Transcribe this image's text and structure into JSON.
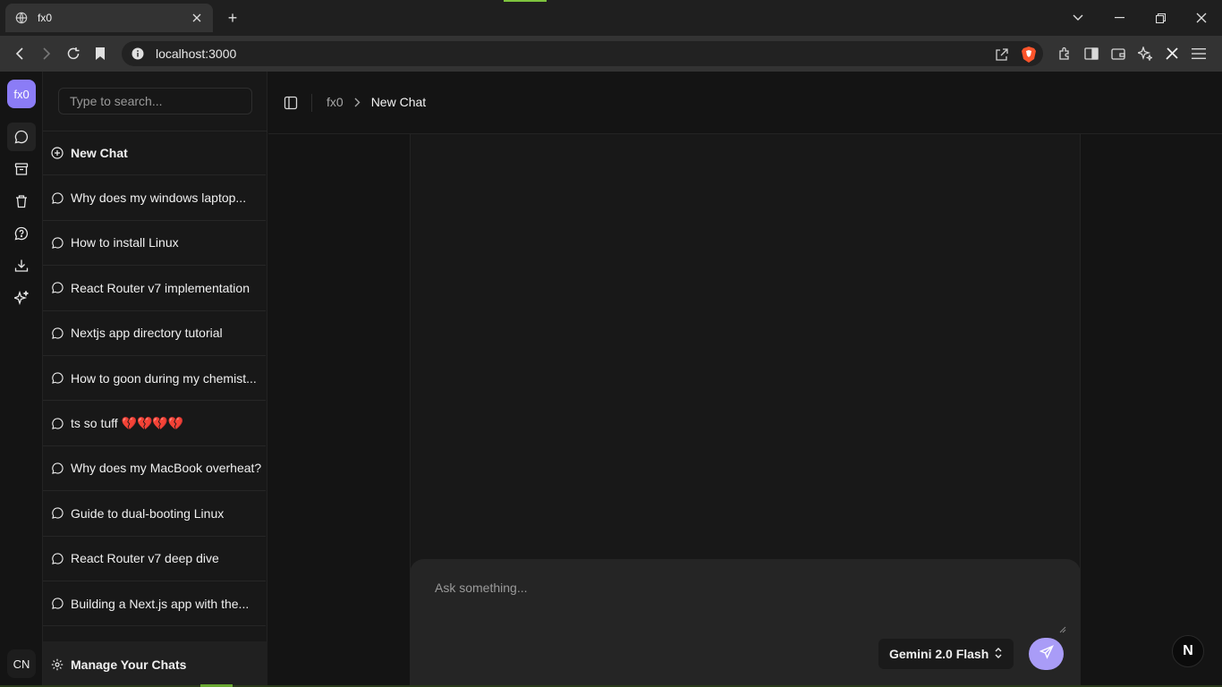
{
  "browser": {
    "tab_title": "fx0",
    "new_tab": "+",
    "url": "localhost:3000"
  },
  "rail": {
    "logo": "fx0",
    "avatar": "CN",
    "icons": [
      "chat-icon",
      "archive-icon",
      "trash-icon",
      "help-icon",
      "download-icon",
      "sparkles-icon"
    ]
  },
  "sidebar": {
    "search_placeholder": "Type to search...",
    "new_chat": "New Chat",
    "chats": [
      {
        "label": "Why does my windows laptop..."
      },
      {
        "label": "How to install Linux"
      },
      {
        "label": "React Router v7 implementation"
      },
      {
        "label": "Nextjs app directory tutorial"
      },
      {
        "label": "How to goon during my chemist..."
      },
      {
        "label": "ts so tuff 💔💔💔💔"
      },
      {
        "label": "Why does my MacBook overheat?"
      },
      {
        "label": "Guide to dual-booting Linux"
      },
      {
        "label": "React Router v7 deep dive"
      },
      {
        "label": "Building a Next.js app with the..."
      }
    ],
    "manage": "Manage Your Chats"
  },
  "header": {
    "crumb_root": "fx0",
    "crumb_current": "New Chat"
  },
  "composer": {
    "placeholder": "Ask something...",
    "model": "Gemini 2.0 Flash"
  },
  "badge": "N",
  "colors": {
    "accent": "#8b7cf6",
    "send": "#a99cf7"
  }
}
